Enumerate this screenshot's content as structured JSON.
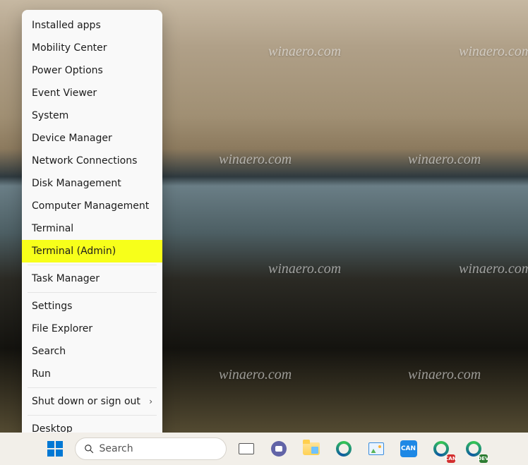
{
  "watermark_text": "winaero.com",
  "context_menu": {
    "items": [
      {
        "label": "Installed apps",
        "has_submenu": false,
        "highlighted": false
      },
      {
        "label": "Mobility Center",
        "has_submenu": false,
        "highlighted": false
      },
      {
        "label": "Power Options",
        "has_submenu": false,
        "highlighted": false
      },
      {
        "label": "Event Viewer",
        "has_submenu": false,
        "highlighted": false
      },
      {
        "label": "System",
        "has_submenu": false,
        "highlighted": false
      },
      {
        "label": "Device Manager",
        "has_submenu": false,
        "highlighted": false
      },
      {
        "label": "Network Connections",
        "has_submenu": false,
        "highlighted": false
      },
      {
        "label": "Disk Management",
        "has_submenu": false,
        "highlighted": false
      },
      {
        "label": "Computer Management",
        "has_submenu": false,
        "highlighted": false
      },
      {
        "label": "Terminal",
        "has_submenu": false,
        "highlighted": false
      },
      {
        "label": "Terminal (Admin)",
        "has_submenu": false,
        "highlighted": true
      },
      {
        "separator": true
      },
      {
        "label": "Task Manager",
        "has_submenu": false,
        "highlighted": false
      },
      {
        "separator": true
      },
      {
        "label": "Settings",
        "has_submenu": false,
        "highlighted": false
      },
      {
        "label": "File Explorer",
        "has_submenu": false,
        "highlighted": false
      },
      {
        "label": "Search",
        "has_submenu": false,
        "highlighted": false
      },
      {
        "label": "Run",
        "has_submenu": false,
        "highlighted": false
      },
      {
        "separator": true
      },
      {
        "label": "Shut down or sign out",
        "has_submenu": true,
        "highlighted": false
      },
      {
        "separator": true
      },
      {
        "label": "Desktop",
        "has_submenu": false,
        "highlighted": false
      }
    ]
  },
  "taskbar": {
    "search_placeholder": "Search",
    "icons": {
      "start": "start-icon",
      "task_view": "task-view-icon",
      "chat": "chat-icon",
      "file_explorer": "file-explorer-icon",
      "edge": "edge-icon",
      "photos": "photos-icon",
      "app_can": "CAN",
      "edge_canary": "CAN",
      "edge_dev": "DEV"
    }
  },
  "colors": {
    "highlight": "#f7ff1a",
    "menu_bg": "#f9f9f9",
    "taskbar_bg": "#f2efe9",
    "start_blue": "#0078d4"
  }
}
